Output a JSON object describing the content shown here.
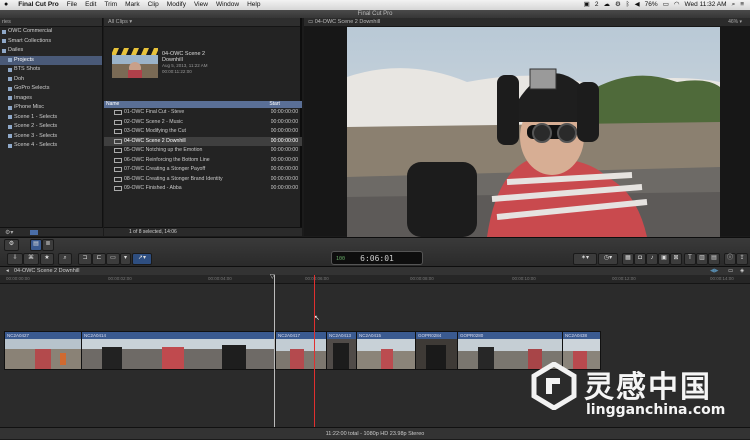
{
  "menubar": {
    "apple": "",
    "app": "Final Cut Pro",
    "items": [
      "File",
      "Edit",
      "Trim",
      "Mark",
      "Clip",
      "Modify",
      "View",
      "Window",
      "Help"
    ],
    "status_number": "2",
    "battery": "76%",
    "clock": "Wed 11:32 AM"
  },
  "window": {
    "title": "Final Cut Pro"
  },
  "library": {
    "header": "ries",
    "items": [
      {
        "label": "OWC Commercial",
        "selected": false
      },
      {
        "label": "Smart Collections",
        "selected": false
      },
      {
        "label": "Dailes",
        "selected": false
      },
      {
        "label": "Projects",
        "selected": true
      },
      {
        "label": "BTS Shots",
        "selected": false
      },
      {
        "label": "Doh",
        "selected": false
      },
      {
        "label": "GoPro Selects",
        "selected": false
      },
      {
        "label": "Images",
        "selected": false
      },
      {
        "label": "iPhone Misc",
        "selected": false
      },
      {
        "label": "Scene 1 - Selects",
        "selected": false
      },
      {
        "label": "Scene 2 - Selects",
        "selected": false
      },
      {
        "label": "Scene 3 - Selects",
        "selected": false
      },
      {
        "label": "Scene 4 - Selects",
        "selected": false
      }
    ]
  },
  "browser": {
    "filter": "All Clips",
    "preview": {
      "title": "04-OWC Scene 2 Downhill",
      "date": "Aug 5, 2013, 11:22 AM",
      "duration": "00:00:11:22:00"
    },
    "columns": {
      "name": "Name",
      "start": "Start"
    },
    "rows": [
      {
        "name": "01-OWC Final Cut - Steve",
        "start": "00:00:00:00"
      },
      {
        "name": "02-OWC Scene 2 - Music",
        "start": "00:00:00:00"
      },
      {
        "name": "03-OWC Modifying the Cut",
        "start": "00:00:00:00"
      },
      {
        "name": "04-OWC Scene 2 Downhill",
        "start": "00:00:00:00",
        "selected": true
      },
      {
        "name": "05-OWC Notching up the Emotion",
        "start": "00:00:00:00"
      },
      {
        "name": "06-OWC Reinforcing the Bottom Line",
        "start": "00:00:00:00"
      },
      {
        "name": "07-OWC Creating a Stonger Payoff",
        "start": "00:00:00:00"
      },
      {
        "name": "08-OWC Creating a Stonger Brand Identity",
        "start": "00:00:00:00"
      },
      {
        "name": "09-OWC Finished - Abba",
        "start": "00:00:00:00"
      }
    ],
    "footer": "1 of 8 selected, 14:06"
  },
  "viewer": {
    "title": "04-OWC Scene 2 Downhill",
    "zoom": "46%"
  },
  "toolbar": {
    "timecode_prefix": "100",
    "timecode": "6:06:01"
  },
  "timeline": {
    "project": "04-OWC Scene 2 Downhill",
    "ruler_ticks": [
      "00:00:00:00",
      "00:00:02:00",
      "00:00:04:00",
      "00:00:06:00",
      "00:00:08:00",
      "00:00:10:00",
      "00:00:12:00",
      "00:00:14:00"
    ],
    "clips": [
      {
        "label": "NC2A0427"
      },
      {
        "label": "NC2A0414"
      },
      {
        "label": "NC2A0417"
      },
      {
        "label": "NC2A0413"
      },
      {
        "label": "NC2A0415"
      },
      {
        "label": "GOPR0284"
      },
      {
        "label": "GOPR0280"
      },
      {
        "label": "NC2A0438"
      }
    ]
  },
  "status": {
    "summary": "11:22:00 total - 1080p HD 23.98p Stereo"
  },
  "watermark": {
    "cn": "灵感中国",
    "url": "lingganchina.com"
  },
  "colors": {
    "selection": "#4a5a78",
    "clip_header": "#3a5a90",
    "playhead": "#e03030"
  }
}
